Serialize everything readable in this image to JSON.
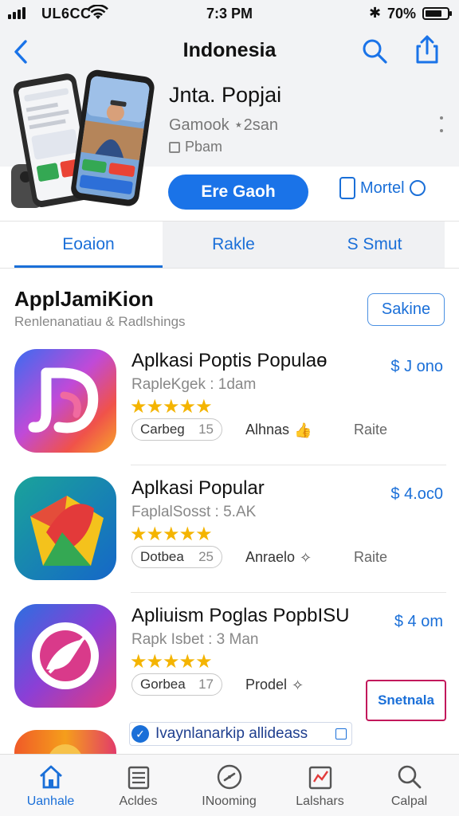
{
  "status_bar": {
    "carrier": "UL6CC",
    "time": "7:3 PM",
    "battery": "70%",
    "battery_level": 0.7
  },
  "header": {
    "title": "Indonesia"
  },
  "hero": {
    "title": "Jnta. Popjai",
    "subtitle": "Gamook ⋆2san",
    "meta": "Pbam",
    "primary_button": "Ere Gaoh",
    "device_link": "Mortel"
  },
  "tabs": [
    {
      "label": "Eoaion"
    },
    {
      "label": "Rakle"
    },
    {
      "label": "S Smut"
    }
  ],
  "section": {
    "title": "ApplJamiKion",
    "subtitle": "Renlenanatiau & Radlshings",
    "button": "Sakine"
  },
  "apps": [
    {
      "name": "Aplkasi Poptis Populaɵ",
      "sub": "RapleKgek : 1dam",
      "rating": 5,
      "price": "$ J ono",
      "pill_label": "Carbeg",
      "pill_num": "15",
      "action": "Alhnas",
      "rate": "Raite"
    },
    {
      "name": "Aplkasi Popular",
      "sub": "FaplalSosst : 5.AK",
      "rating": 5,
      "price": "$ 4.oc0",
      "pill_label": "Dotbea",
      "pill_num": "25",
      "action": "Anraelo",
      "rate": "Raite"
    },
    {
      "name": "Apliuism Poglas PopbISU",
      "sub": "Rapk Isbet : 3 Man",
      "rating": 5,
      "price": "$ 4 om",
      "pill_label": "Gorbea",
      "pill_num": "17",
      "action": "Prodel",
      "rate": "Snetnala"
    }
  ],
  "promo": {
    "text": "Ivaynlanarkip allideass"
  },
  "tabbar": [
    {
      "label": "Uanhale",
      "icon": "home-icon"
    },
    {
      "label": "Acldes",
      "icon": "list-icon"
    },
    {
      "label": "INooming",
      "icon": "compass-icon"
    },
    {
      "label": "Lalshars",
      "icon": "chart-icon"
    },
    {
      "label": "Calpal",
      "icon": "search-icon"
    }
  ]
}
